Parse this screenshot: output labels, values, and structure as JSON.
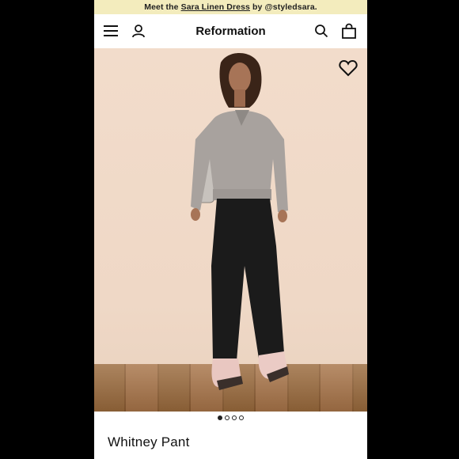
{
  "promo": {
    "prefix": "Meet the",
    "link": "Sara Linen Dress",
    "suffix": "by @styledsara."
  },
  "header": {
    "brand": "Reformation"
  },
  "icons": {
    "menu": "hamburger-menu-icon",
    "account": "user-icon",
    "search": "search-icon",
    "bag": "shopping-bag-icon",
    "favorite": "heart-icon"
  },
  "carousel": {
    "current": 1,
    "total": 4
  },
  "product": {
    "name": "Whitney Pant"
  }
}
